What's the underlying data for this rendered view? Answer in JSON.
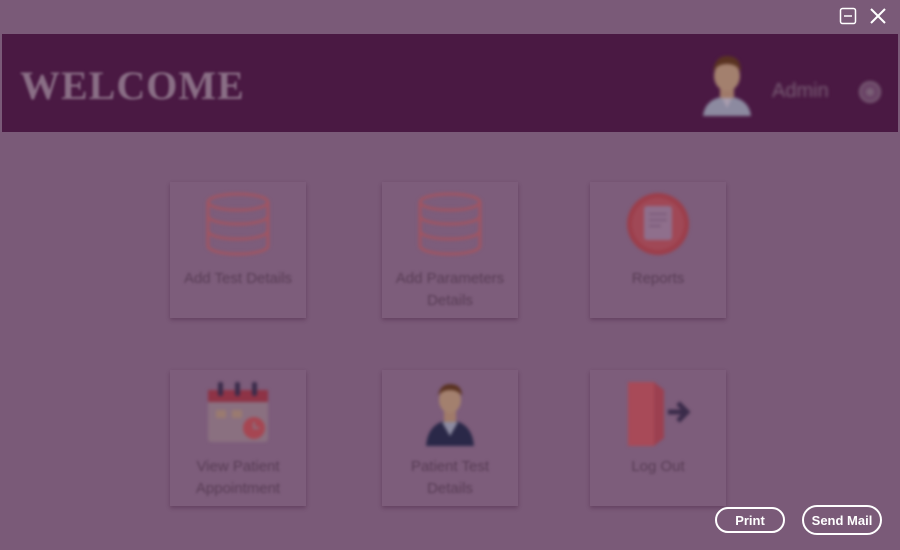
{
  "header": {
    "title": "WELCOME",
    "user_name": "Admin"
  },
  "tiles": [
    {
      "label": "Add Test Details",
      "icon": "database-icon"
    },
    {
      "label": "Add Parameters Details",
      "icon": "database-icon"
    },
    {
      "label": "Reports",
      "icon": "reports-icon"
    },
    {
      "label": "View Patient Appointment",
      "icon": "calendar-icon"
    },
    {
      "label": "Patient Test Details",
      "icon": "patient-icon"
    },
    {
      "label": "Log Out",
      "icon": "logout-door-icon"
    }
  ],
  "footer": {
    "print_label": "Print",
    "send_mail_label": "Send Mail"
  },
  "colors": {
    "background": "#7a5a78",
    "header_bar": "#4a1943",
    "button_border": "#ffffff"
  }
}
